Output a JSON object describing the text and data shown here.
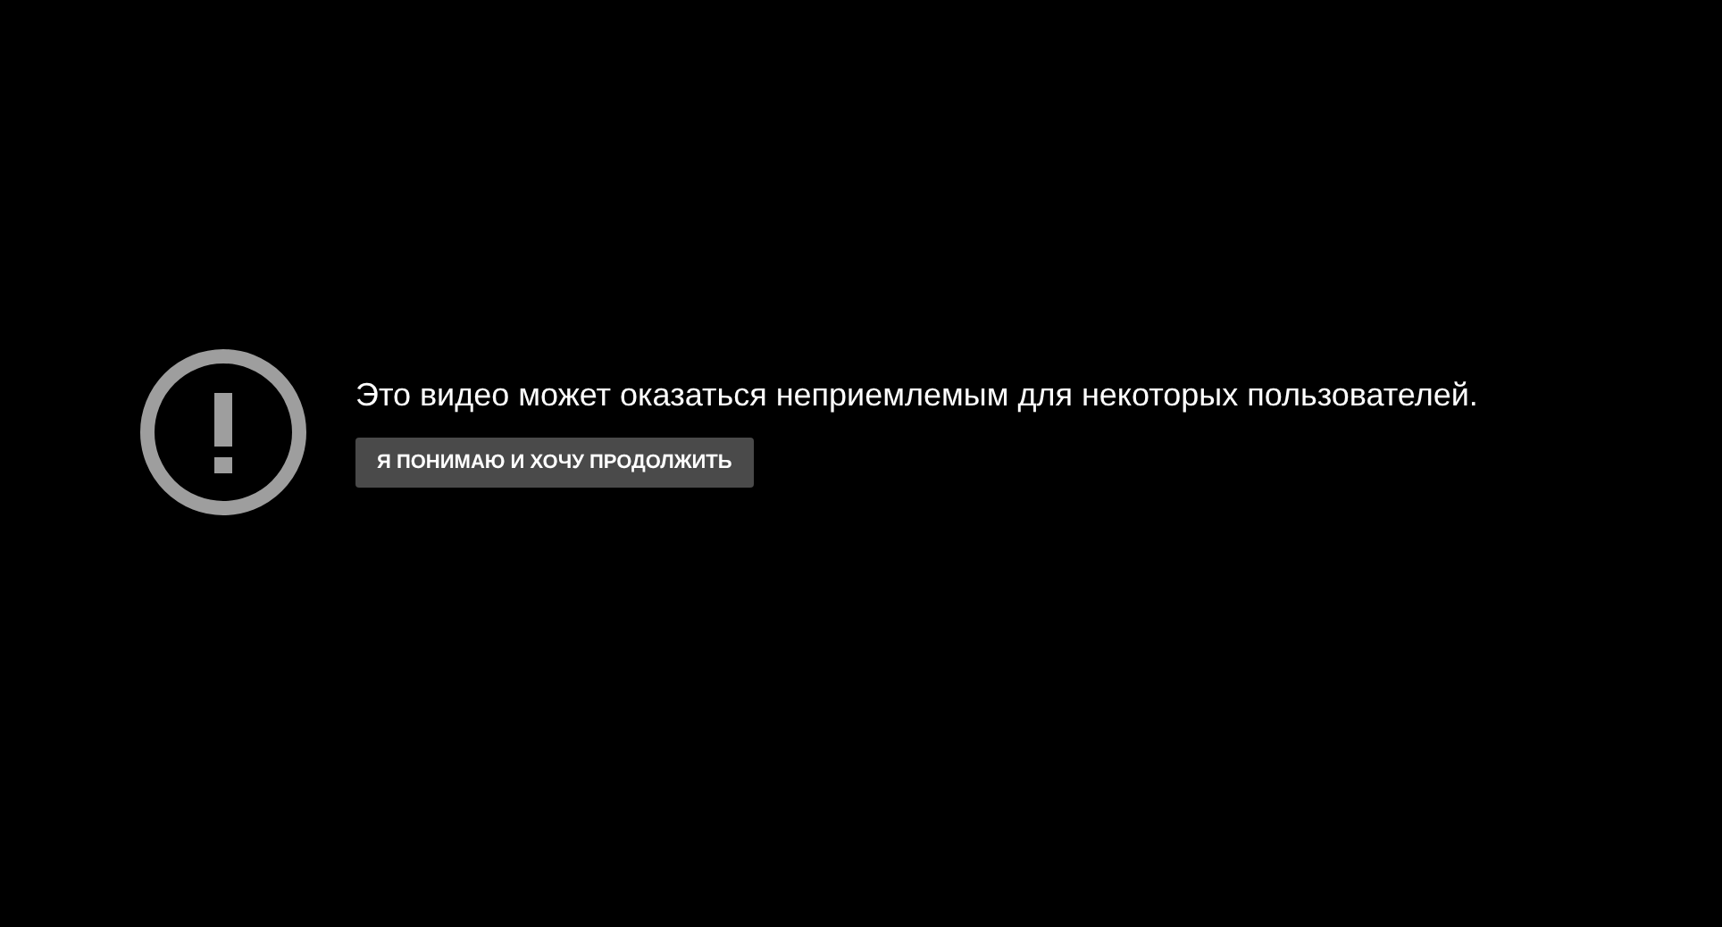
{
  "message": "Это видео может оказаться неприемлемым для некоторых пользователей.",
  "button": "Я ПОНИМАЮ И ХОЧУ ПРОДОЛЖИТЬ"
}
